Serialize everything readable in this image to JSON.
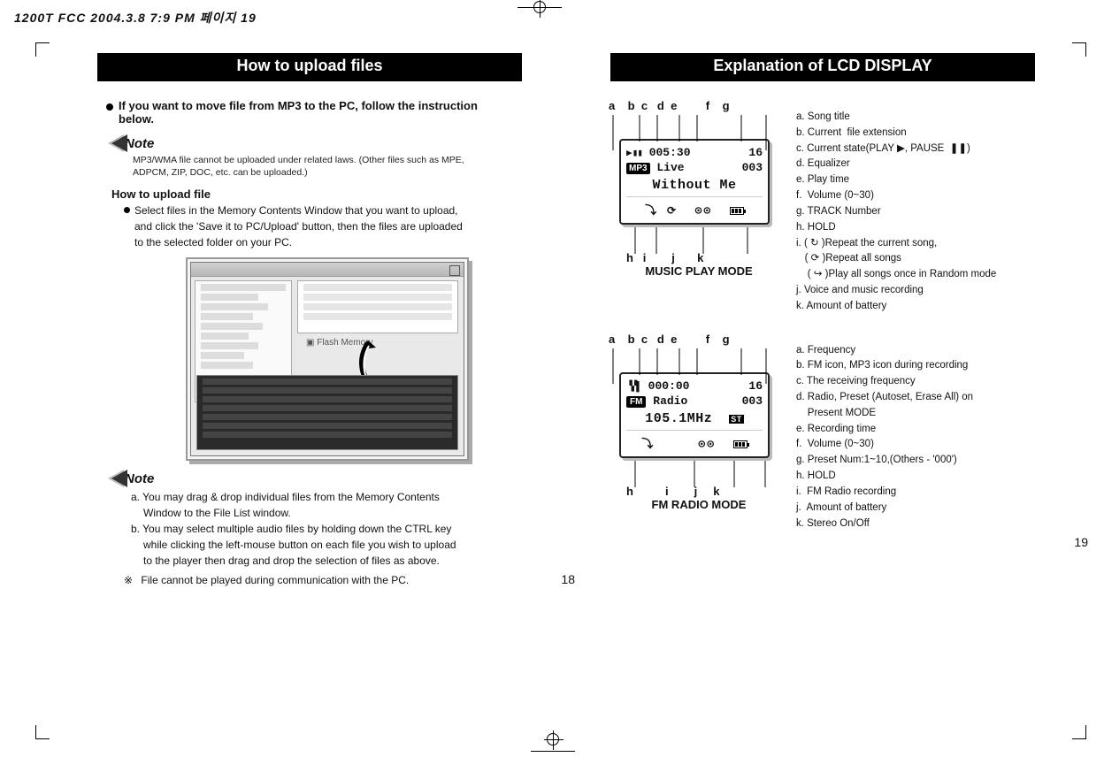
{
  "header": "1200T FCC   2004.3.8 7:9 PM   페이지 19",
  "left": {
    "banner": "How to upload files",
    "intro1": "If you want to move file from MP3 to the PC, follow the instruction",
    "intro2": "below.",
    "note_label": "Note",
    "note1a": "MP3/WMA file cannot be uploaded under related laws. (Other files such as MPE,",
    "note1b": "ADPCM, ZIP, DOC, etc.  can be uploaded.)",
    "subhead": "How to upload file",
    "body1": "Select files in the Memory Contents Window  that you want to upload,",
    "body2": "and click the 'Save it to PC/Upload' button, then the files are uploaded",
    "body3": "to the selected folder on your PC.",
    "note2a": "a. You may drag & drop individual files from the Memory Contents",
    "note2a2": "Window to the File List window.",
    "note2b": "b. You may select multiple audio files by holding down the CTRL key",
    "note2b2": "while clicking the left-mouse button on each file you wish to upload",
    "note2b3": "to the player then drag and drop the selection of files as above.",
    "star_line": "File cannot be played during communication with the PC.",
    "pagenum": "18"
  },
  "right": {
    "banner": "Explanation of LCD DISPLAY",
    "music": {
      "top_labels": "a    b  c   d  e         f    g",
      "bottom_labels": "h   i        j       k",
      "lcd_time": "005:30",
      "lcd_vol": "16",
      "lcd_eq": "Live",
      "lcd_track": "003",
      "lcd_title": "Without Me",
      "mode_title": "MUSIC PLAY MODE",
      "legend": {
        "a": "a. Song title",
        "b": "b. Current  file extension",
        "c": "c. Current state(PLAY ▶, PAUSE  ❚❚)",
        "d": "d. Equalizer",
        "e": "e. Play time",
        "f": "f.  Volume (0~30)",
        "g": "g. TRACK Number",
        "h": "h. HOLD",
        "i1": "i. ( ↻ )Repeat the current song,",
        "i2": "   ( ⟳ )Repeat all songs",
        "i3": "    ( ↪ )Play all songs once in Random mode",
        "j": "j. Voice and music recording",
        "k": "k. Amount of battery"
      }
    },
    "fm": {
      "top_labels": "a    b  c   d  e         f    g",
      "bottom_labels": "h          i        j     k",
      "lcd_time": "000:00",
      "lcd_vol": "16",
      "lcd_mode": "Radio",
      "lcd_preset": "003",
      "lcd_freq": "105.1MHz",
      "mode_title": "FM RADIO MODE",
      "legend": {
        "a": "a. Frequency",
        "b": "b. FM icon, MP3 icon during recording",
        "c": "c. The receiving frequency",
        "d": "d. Radio, Preset (Autoset, Erase All) on",
        "d2": "    Present MODE",
        "e": "e. Recording time",
        "f": "f.  Volume (0~30)",
        "g": "g. Preset Num:1~10,(Others - '000')",
        "h": "h. HOLD",
        "i": "i.  FM Radio recording",
        "j": "j.  Amount of battery",
        "k": "k. Stereo On/Off"
      }
    },
    "pagenum": "19"
  }
}
